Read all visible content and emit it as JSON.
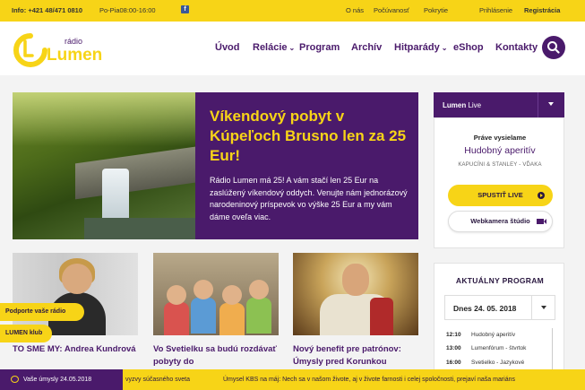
{
  "topbar": {
    "info": "Info: +421 48/471 0810",
    "hours": "Po-Pia08:00-16:00",
    "facebook_icon": "facebook-icon",
    "links": [
      "O nás",
      "Počúvanosť",
      "Pokrytie"
    ],
    "login": "Prihlásenie",
    "register": "Registrácia"
  },
  "logo": {
    "small": "rádio",
    "big": "Lumen"
  },
  "nav": {
    "items": [
      "Úvod",
      "Relácie",
      "Program",
      "Archív",
      "Hitparády",
      "eShop",
      "Kontakty"
    ],
    "search_icon": "search-icon"
  },
  "feature": {
    "title": "Víkendový pobyt v Kúpeľoch Brusno len za 25 Eur!",
    "text": "Rádio Lumen má 25! A vám stačí len 25 Eur na zaslúžený víkendový oddych. Venujte nám jednorázový narodeninový príspevok vo výške 25 Eur a my vám dáme oveľa viac."
  },
  "cards": [
    {
      "title": "TO SME MY: Andrea Kundrová"
    },
    {
      "title": "Vo Svetielku sa budú rozdávať pobyty do"
    },
    {
      "title": "Nový benefit pre patrónov: Úmysly pred Korunkou"
    }
  ],
  "live": {
    "head_bold": "Lumen",
    "head_rest": " Live",
    "now_label": "Práve vysielame",
    "show": "Hudobný aperitív",
    "track": "KAPUCÍNI & STANLEY - VĎAKA",
    "play_button": "SPUSTIŤ LIVE",
    "cam_button": "Webkamera štúdio"
  },
  "program": {
    "title": "AKTUÁLNY PROGRAM",
    "date": "Dnes 24. 05. 2018",
    "rows": [
      {
        "time": "12:10",
        "name": "Hudobný aperitív"
      },
      {
        "time": "13:00",
        "name": "Lumenfórum - štvrtok"
      },
      {
        "time": "16:00",
        "name": "Svetielko - Jazykové"
      }
    ]
  },
  "floating": {
    "support": "Podporte vaše rádio",
    "club": "LUMEN klub"
  },
  "ticker": {
    "tag": "Vaše úmysly 24.05.2018",
    "msg1": "vyzvy súčasného sveta",
    "msg2": "Úmysel KBS na máj: Nech sa v našom živote, aj v živote farnosti i celej spoločnosti, prejaví naša mariáns"
  },
  "colors": {
    "purple": "#4a1a6b",
    "yellow": "#f7d417"
  }
}
